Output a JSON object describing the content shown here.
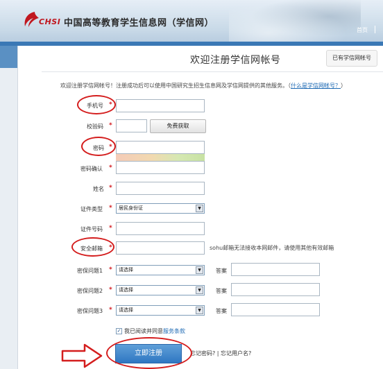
{
  "header": {
    "logo_text": "CHSI",
    "site_title": "中国高等教育学生信息网（学信网）",
    "nav_home": "首页",
    "colors": {
      "brand_red": "#c0171f",
      "stripe_blue": "#3a78b5"
    }
  },
  "page": {
    "title": "欢迎注册学信网帐号",
    "have_account": "已有学信网帐号",
    "intro": "欢迎注册学信网帐号！注册成功后可以使用中国研究生招生信息网及学信网提供的其他服务。（",
    "intro_link": "什么是学信网帐号？",
    "intro_end": "）"
  },
  "form": {
    "req_mark": "*",
    "phone_label": "手机号",
    "code_label": "校验码",
    "code_button": "免费获取",
    "password_label": "密码",
    "confirm_label": "密码确认",
    "name_label": "姓名",
    "id_type_label": "证件类型",
    "id_type_value": "居民身份证",
    "id_no_label": "证件号码",
    "email_label": "安全邮箱",
    "email_hint": "sohu邮箱无法接收本网邮件，请使用其他有效邮箱",
    "q1_label": "密保问题1",
    "q2_label": "密保问题2",
    "q3_label": "密保问题3",
    "question_value": "请选择",
    "answer_label": "答案",
    "select_arrow": "▼",
    "agree_check": "✓",
    "agree_text": "我已阅读并同意",
    "agree_link": "服务条款",
    "submit": "立即注册",
    "forgot": "忘记密码? | 忘记用户名?"
  },
  "annotation": {
    "color": "#d41d1d"
  }
}
